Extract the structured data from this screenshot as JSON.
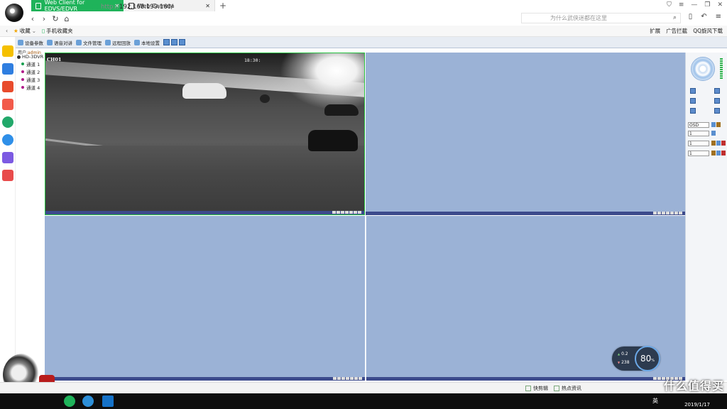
{
  "browser": {
    "tabs": [
      {
        "label": "Web Client for EDVS/EDVR",
        "active": true
      },
      {
        "label": "Web Camera",
        "active": false
      }
    ],
    "url_scheme": "http://",
    "url_host": "192.168.199.160/",
    "search_placeholder": "为什么武侠迷都在这里",
    "bookmarks": [
      {
        "label": "收藏"
      },
      {
        "label": "手机收藏夹"
      }
    ],
    "bookmarks_right": [
      "扩展",
      "广告拦截",
      "QQ旋风下载"
    ],
    "accent": "#1fb35a"
  },
  "client": {
    "toolbar": [
      {
        "label": "设备参数"
      },
      {
        "label": "语音对讲"
      },
      {
        "label": "文件管理"
      },
      {
        "label": "远程回放"
      },
      {
        "label": "本地设置"
      }
    ],
    "user_label": "用户:",
    "user_name": "admin",
    "tree": {
      "root": "HD-3DVR",
      "channels": [
        {
          "label": "通道 1",
          "color": "#1aa050"
        },
        {
          "label": "通道 2",
          "color": "#b01a8a"
        },
        {
          "label": "通道 3",
          "color": "#b01a8a"
        },
        {
          "label": "通道 4",
          "color": "#b01a8a"
        }
      ]
    },
    "camera": {
      "channel_label": "CH01",
      "timestamp": "18:30:"
    },
    "ptz": {
      "osd_label": "OSD",
      "sel_values": [
        "1",
        "1",
        "1"
      ]
    },
    "pane_color": "#9bb2d6"
  },
  "speed_widget": {
    "up": "0.2",
    "down": "238",
    "percent": "80",
    "percent_unit": "%"
  },
  "statusbar": {
    "items": [
      "快剪辑",
      "热点资讯"
    ]
  },
  "taskbar": {
    "lang": "英",
    "date": "2019/1/17"
  },
  "watermark": "什么值得买"
}
